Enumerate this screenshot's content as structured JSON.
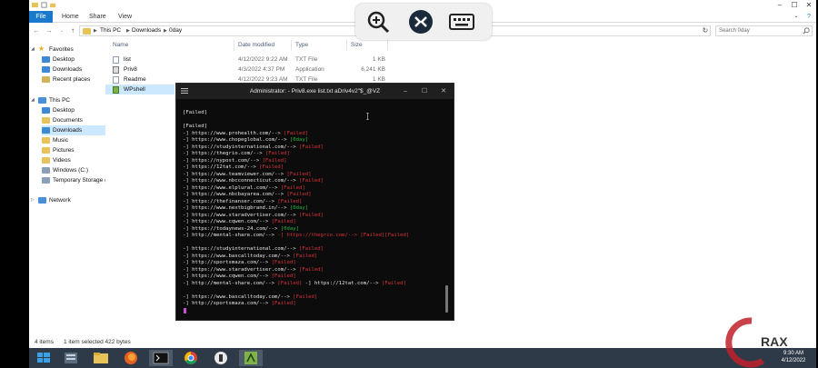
{
  "ribbon": {
    "tabs": [
      "File",
      "Home",
      "Share",
      "View"
    ]
  },
  "address": {
    "crumbs": [
      "This PC",
      "Downloads",
      "0day"
    ],
    "search_placeholder": "Search 0day"
  },
  "nav": {
    "quick_access": "Favorites",
    "favorites": [
      "Desktop",
      "Downloads",
      "Recent places"
    ],
    "this_pc": "This PC",
    "pc_items": [
      "Desktop",
      "Documents",
      "Downloads",
      "Music",
      "Pictures",
      "Videos",
      "Windows (C:)",
      "Temporary Storage ("
    ],
    "network": "Network",
    "selected": "Downloads"
  },
  "columns": {
    "name": "Name",
    "date": "Date modified",
    "type": "Type",
    "size": "Size"
  },
  "files": [
    {
      "name": "list",
      "date": "4/12/2022 9:22 AM",
      "type": "TXT File",
      "size": "1 KB"
    },
    {
      "name": "Priv8",
      "date": "4/3/2022 4:37 PM",
      "type": "Application",
      "size": "6,241 KB"
    },
    {
      "name": "Readme",
      "date": "4/12/2022 9:23 AM",
      "type": "TXT File",
      "size": "1 KB"
    },
    {
      "name": "WPshell",
      "date": "",
      "type": "",
      "size": ""
    }
  ],
  "status": {
    "count": "4 items",
    "selection": "1 item selected  422 bytes"
  },
  "terminal": {
    "title": "Administrator: - Priv8.exe list.txt aDriv4v2\"$_@VZ",
    "lines": [
      [
        {
          "t": "[Failed]"
        }
      ],
      [
        {
          "t": ""
        }
      ],
      [
        {
          "t": "[Failed]"
        }
      ],
      [
        {
          "t": "-] https://www.prohealth.com/--> "
        },
        {
          "t": "[Failed]",
          "c": "f"
        }
      ],
      [
        {
          "t": "-] https://www.chopeglobal.com/--> "
        },
        {
          "t": "[0day]",
          "c": "o"
        }
      ],
      [
        {
          "t": "-] https://studyinternational.com/--> "
        },
        {
          "t": "[Failed]",
          "c": "f"
        }
      ],
      [
        {
          "t": "-] https://thegrio.com/--> "
        },
        {
          "t": "[Failed]",
          "c": "f"
        }
      ],
      [
        {
          "t": "-] https://nypost.com/--> "
        },
        {
          "t": "[Failed]",
          "c": "f"
        }
      ],
      [
        {
          "t": "-] https://12tat.com/--> "
        },
        {
          "t": "[Failed]",
          "c": "f"
        }
      ],
      [
        {
          "t": "-] https://www.teamviewer.com/--> "
        },
        {
          "t": "[Failed]",
          "c": "f"
        }
      ],
      [
        {
          "t": "-] https://www.nbcconnecticut.com/--> "
        },
        {
          "t": "[Failed]",
          "c": "f"
        }
      ],
      [
        {
          "t": "-] https://www.elplural.com/--> "
        },
        {
          "t": "[Failed]",
          "c": "f"
        }
      ],
      [
        {
          "t": "-] https://www.nbcbayarea.com/--> "
        },
        {
          "t": "[Failed]",
          "c": "f"
        }
      ],
      [
        {
          "t": "-] https://thefinanser.com/--> "
        },
        {
          "t": "[Failed]",
          "c": "f"
        }
      ],
      [
        {
          "t": "-] https://www.nextbigbrand.in/--> "
        },
        {
          "t": "[0day]",
          "c": "o"
        }
      ],
      [
        {
          "t": "-] https://www.staradvertiser.com/--> "
        },
        {
          "t": "[Failed]",
          "c": "f"
        }
      ],
      [
        {
          "t": "-] https://www.cqwen.com/--> "
        },
        {
          "t": "[Failed]",
          "c": "f"
        }
      ],
      [
        {
          "t": "-] https://todaynews-24.com/--> "
        },
        {
          "t": "[0day]",
          "c": "o"
        }
      ],
      [
        {
          "t": "-] http://mental-share.com/--> "
        },
        {
          "t": "-] https://thegrio.com/--> [Failed][Failed]",
          "c": "f"
        }
      ],
      [
        {
          "t": ""
        }
      ],
      [
        {
          "t": "-] https://studyinternational.com/--> "
        },
        {
          "t": "[Failed]",
          "c": "f"
        }
      ],
      [
        {
          "t": "-] https://www.bascalltoday.com/--> "
        },
        {
          "t": "[Failed]",
          "c": "f"
        }
      ],
      [
        {
          "t": "-] http://sportsmaza.com/--> "
        },
        {
          "t": "[Failed]",
          "c": "f"
        }
      ],
      [
        {
          "t": "-] https://www.staradvertiser.com/--> "
        },
        {
          "t": "[Failed]",
          "c": "f"
        }
      ],
      [
        {
          "t": "-] https://www.cqwen.com/--> "
        },
        {
          "t": "[Failed]",
          "c": "f"
        }
      ],
      [
        {
          "t": "-] http://mental-share.com/--> "
        },
        {
          "t": "[Failed]",
          "c": "f"
        },
        {
          "t": " -] https://12tat.com/--> "
        },
        {
          "t": "[Failed]",
          "c": "f"
        }
      ],
      [
        {
          "t": ""
        }
      ],
      [
        {
          "t": "-] https://www.bascalltoday.com/--> "
        },
        {
          "t": "[Failed]",
          "c": "f"
        }
      ],
      [
        {
          "t": "-] http://sportsmaza.com/--> "
        },
        {
          "t": "[Failed]",
          "c": "f"
        }
      ]
    ]
  },
  "taskbar": {
    "apps": [
      "start-button",
      "server-manager",
      "file-explorer",
      "firefox",
      "terminal",
      "chrome",
      "pulse-secure",
      "priv8"
    ],
    "time": "9:30 AM",
    "date": "4/12/2022"
  },
  "watermark": {
    "text": "RAX",
    "brand_color": "#c0202a"
  },
  "colors": {
    "accent": "#1979ca",
    "selection": "#cce8ff",
    "failed": "#d6343a",
    "zeroday": "#27b83b"
  }
}
